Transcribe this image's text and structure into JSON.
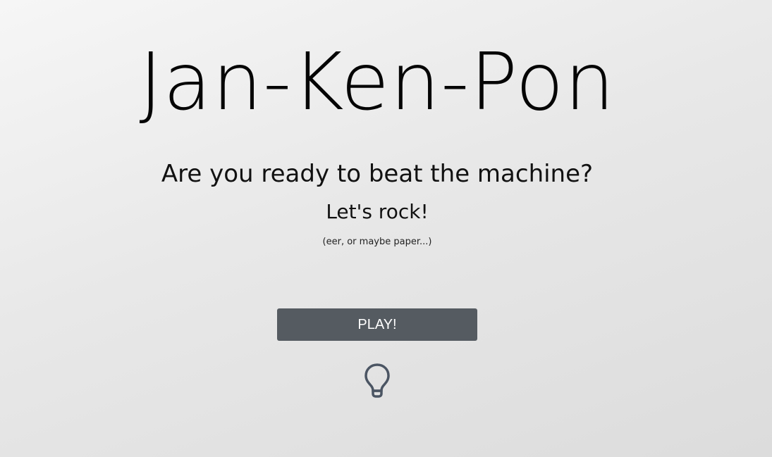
{
  "header": {
    "title": "Jan-Ken-Pon"
  },
  "intro": {
    "question": "Are you ready to beat the machine?",
    "tagline": "Let's rock!",
    "note": "(eer, or maybe paper...)"
  },
  "actions": {
    "play_label": "PLAY!",
    "hint_icon": "lightbulb-icon"
  },
  "colors": {
    "button_bg": "#555b61",
    "button_text": "#ffffff",
    "icon_stroke": "#4b5563"
  }
}
